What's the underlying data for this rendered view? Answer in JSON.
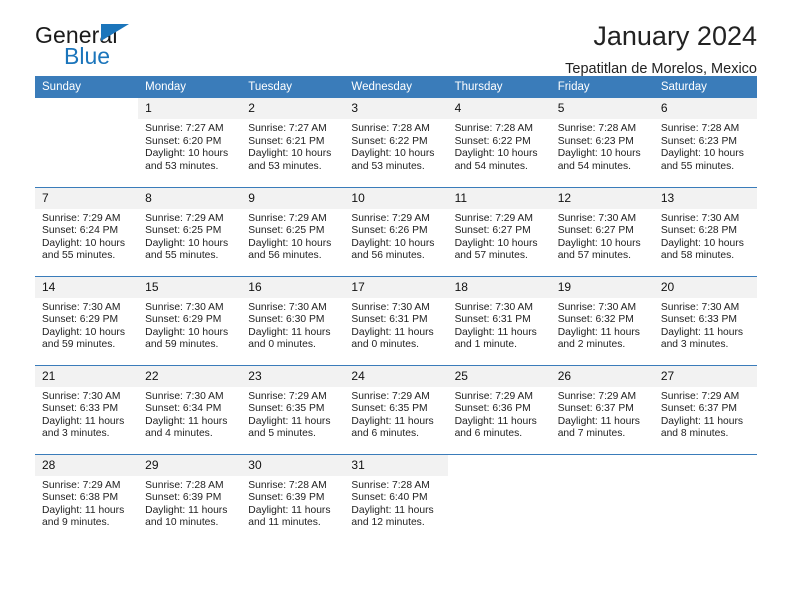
{
  "logo": {
    "word_one": "General",
    "word_two": "Blue",
    "triangle_color": "#1b75bb"
  },
  "header": {
    "title": "January 2024",
    "subtitle": "Tepatitlan de Morelos, Mexico"
  },
  "theme": {
    "header_bg": "#3a7cba",
    "daynum_bg": "#f2f2f2",
    "grid_line": "#3a7cba",
    "text": "#222222"
  },
  "weekdays": [
    "Sunday",
    "Monday",
    "Tuesday",
    "Wednesday",
    "Thursday",
    "Friday",
    "Saturday"
  ],
  "weeks": [
    [
      {
        "day": "",
        "sunrise": "",
        "sunset": "",
        "daylight_line1": "",
        "daylight_line2": ""
      },
      {
        "day": "1",
        "sunrise": "Sunrise: 7:27 AM",
        "sunset": "Sunset: 6:20 PM",
        "daylight_line1": "Daylight: 10 hours",
        "daylight_line2": "and 53 minutes."
      },
      {
        "day": "2",
        "sunrise": "Sunrise: 7:27 AM",
        "sunset": "Sunset: 6:21 PM",
        "daylight_line1": "Daylight: 10 hours",
        "daylight_line2": "and 53 minutes."
      },
      {
        "day": "3",
        "sunrise": "Sunrise: 7:28 AM",
        "sunset": "Sunset: 6:22 PM",
        "daylight_line1": "Daylight: 10 hours",
        "daylight_line2": "and 53 minutes."
      },
      {
        "day": "4",
        "sunrise": "Sunrise: 7:28 AM",
        "sunset": "Sunset: 6:22 PM",
        "daylight_line1": "Daylight: 10 hours",
        "daylight_line2": "and 54 minutes."
      },
      {
        "day": "5",
        "sunrise": "Sunrise: 7:28 AM",
        "sunset": "Sunset: 6:23 PM",
        "daylight_line1": "Daylight: 10 hours",
        "daylight_line2": "and 54 minutes."
      },
      {
        "day": "6",
        "sunrise": "Sunrise: 7:28 AM",
        "sunset": "Sunset: 6:23 PM",
        "daylight_line1": "Daylight: 10 hours",
        "daylight_line2": "and 55 minutes."
      }
    ],
    [
      {
        "day": "7",
        "sunrise": "Sunrise: 7:29 AM",
        "sunset": "Sunset: 6:24 PM",
        "daylight_line1": "Daylight: 10 hours",
        "daylight_line2": "and 55 minutes."
      },
      {
        "day": "8",
        "sunrise": "Sunrise: 7:29 AM",
        "sunset": "Sunset: 6:25 PM",
        "daylight_line1": "Daylight: 10 hours",
        "daylight_line2": "and 55 minutes."
      },
      {
        "day": "9",
        "sunrise": "Sunrise: 7:29 AM",
        "sunset": "Sunset: 6:25 PM",
        "daylight_line1": "Daylight: 10 hours",
        "daylight_line2": "and 56 minutes."
      },
      {
        "day": "10",
        "sunrise": "Sunrise: 7:29 AM",
        "sunset": "Sunset: 6:26 PM",
        "daylight_line1": "Daylight: 10 hours",
        "daylight_line2": "and 56 minutes."
      },
      {
        "day": "11",
        "sunrise": "Sunrise: 7:29 AM",
        "sunset": "Sunset: 6:27 PM",
        "daylight_line1": "Daylight: 10 hours",
        "daylight_line2": "and 57 minutes."
      },
      {
        "day": "12",
        "sunrise": "Sunrise: 7:30 AM",
        "sunset": "Sunset: 6:27 PM",
        "daylight_line1": "Daylight: 10 hours",
        "daylight_line2": "and 57 minutes."
      },
      {
        "day": "13",
        "sunrise": "Sunrise: 7:30 AM",
        "sunset": "Sunset: 6:28 PM",
        "daylight_line1": "Daylight: 10 hours",
        "daylight_line2": "and 58 minutes."
      }
    ],
    [
      {
        "day": "14",
        "sunrise": "Sunrise: 7:30 AM",
        "sunset": "Sunset: 6:29 PM",
        "daylight_line1": "Daylight: 10 hours",
        "daylight_line2": "and 59 minutes."
      },
      {
        "day": "15",
        "sunrise": "Sunrise: 7:30 AM",
        "sunset": "Sunset: 6:29 PM",
        "daylight_line1": "Daylight: 10 hours",
        "daylight_line2": "and 59 minutes."
      },
      {
        "day": "16",
        "sunrise": "Sunrise: 7:30 AM",
        "sunset": "Sunset: 6:30 PM",
        "daylight_line1": "Daylight: 11 hours",
        "daylight_line2": "and 0 minutes."
      },
      {
        "day": "17",
        "sunrise": "Sunrise: 7:30 AM",
        "sunset": "Sunset: 6:31 PM",
        "daylight_line1": "Daylight: 11 hours",
        "daylight_line2": "and 0 minutes."
      },
      {
        "day": "18",
        "sunrise": "Sunrise: 7:30 AM",
        "sunset": "Sunset: 6:31 PM",
        "daylight_line1": "Daylight: 11 hours",
        "daylight_line2": "and 1 minute."
      },
      {
        "day": "19",
        "sunrise": "Sunrise: 7:30 AM",
        "sunset": "Sunset: 6:32 PM",
        "daylight_line1": "Daylight: 11 hours",
        "daylight_line2": "and 2 minutes."
      },
      {
        "day": "20",
        "sunrise": "Sunrise: 7:30 AM",
        "sunset": "Sunset: 6:33 PM",
        "daylight_line1": "Daylight: 11 hours",
        "daylight_line2": "and 3 minutes."
      }
    ],
    [
      {
        "day": "21",
        "sunrise": "Sunrise: 7:30 AM",
        "sunset": "Sunset: 6:33 PM",
        "daylight_line1": "Daylight: 11 hours",
        "daylight_line2": "and 3 minutes."
      },
      {
        "day": "22",
        "sunrise": "Sunrise: 7:30 AM",
        "sunset": "Sunset: 6:34 PM",
        "daylight_line1": "Daylight: 11 hours",
        "daylight_line2": "and 4 minutes."
      },
      {
        "day": "23",
        "sunrise": "Sunrise: 7:29 AM",
        "sunset": "Sunset: 6:35 PM",
        "daylight_line1": "Daylight: 11 hours",
        "daylight_line2": "and 5 minutes."
      },
      {
        "day": "24",
        "sunrise": "Sunrise: 7:29 AM",
        "sunset": "Sunset: 6:35 PM",
        "daylight_line1": "Daylight: 11 hours",
        "daylight_line2": "and 6 minutes."
      },
      {
        "day": "25",
        "sunrise": "Sunrise: 7:29 AM",
        "sunset": "Sunset: 6:36 PM",
        "daylight_line1": "Daylight: 11 hours",
        "daylight_line2": "and 6 minutes."
      },
      {
        "day": "26",
        "sunrise": "Sunrise: 7:29 AM",
        "sunset": "Sunset: 6:37 PM",
        "daylight_line1": "Daylight: 11 hours",
        "daylight_line2": "and 7 minutes."
      },
      {
        "day": "27",
        "sunrise": "Sunrise: 7:29 AM",
        "sunset": "Sunset: 6:37 PM",
        "daylight_line1": "Daylight: 11 hours",
        "daylight_line2": "and 8 minutes."
      }
    ],
    [
      {
        "day": "28",
        "sunrise": "Sunrise: 7:29 AM",
        "sunset": "Sunset: 6:38 PM",
        "daylight_line1": "Daylight: 11 hours",
        "daylight_line2": "and 9 minutes."
      },
      {
        "day": "29",
        "sunrise": "Sunrise: 7:28 AM",
        "sunset": "Sunset: 6:39 PM",
        "daylight_line1": "Daylight: 11 hours",
        "daylight_line2": "and 10 minutes."
      },
      {
        "day": "30",
        "sunrise": "Sunrise: 7:28 AM",
        "sunset": "Sunset: 6:39 PM",
        "daylight_line1": "Daylight: 11 hours",
        "daylight_line2": "and 11 minutes."
      },
      {
        "day": "31",
        "sunrise": "Sunrise: 7:28 AM",
        "sunset": "Sunset: 6:40 PM",
        "daylight_line1": "Daylight: 11 hours",
        "daylight_line2": "and 12 minutes."
      },
      {
        "day": "",
        "sunrise": "",
        "sunset": "",
        "daylight_line1": "",
        "daylight_line2": ""
      },
      {
        "day": "",
        "sunrise": "",
        "sunset": "",
        "daylight_line1": "",
        "daylight_line2": ""
      },
      {
        "day": "",
        "sunrise": "",
        "sunset": "",
        "daylight_line1": "",
        "daylight_line2": ""
      }
    ]
  ]
}
